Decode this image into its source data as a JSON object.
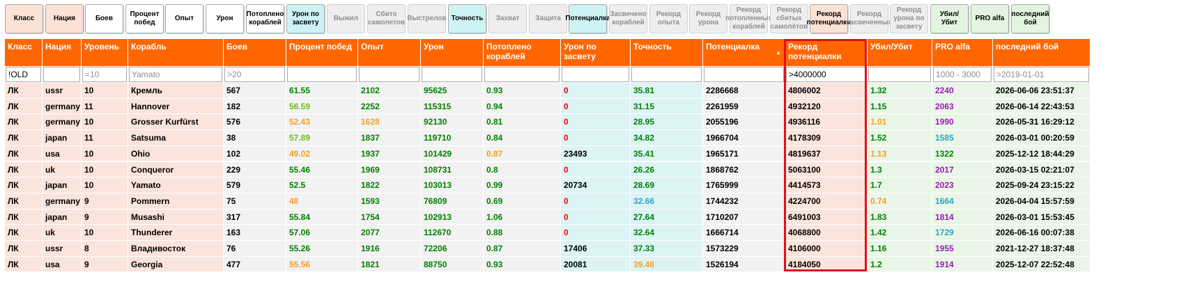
{
  "toggle_buttons": [
    {
      "label": "Класс",
      "state": "salmon"
    },
    {
      "label": "Нация",
      "state": "salmon"
    },
    {
      "label": "Боев",
      "state": "white"
    },
    {
      "label": "Процент побед",
      "state": "white"
    },
    {
      "label": "Опыт",
      "state": "white"
    },
    {
      "label": "Урон",
      "state": "white"
    },
    {
      "label": "Потоплено кораблей",
      "state": "white"
    },
    {
      "label": "Урон по засвету",
      "state": "cyan"
    },
    {
      "label": "Выжил",
      "state": "off"
    },
    {
      "label": "Сбито самолетов",
      "state": "off"
    },
    {
      "label": "Выстрелов",
      "state": "off"
    },
    {
      "label": "Точность",
      "state": "cyan"
    },
    {
      "label": "Захват",
      "state": "off"
    },
    {
      "label": "Защита",
      "state": "off"
    },
    {
      "label": "Потенциалка",
      "state": "cyan"
    },
    {
      "label": "Засвечено кораблей",
      "state": "off"
    },
    {
      "label": "Рекорд опыта",
      "state": "off"
    },
    {
      "label": "Рекорд урона",
      "state": "off"
    },
    {
      "label": "Рекорд потопленных кораблей",
      "state": "off"
    },
    {
      "label": "Рекорд сбитых самолётов",
      "state": "off"
    },
    {
      "label": "Рекорд потенциалки",
      "state": "salmon"
    },
    {
      "label": "Рекорд засвеченных",
      "state": "off"
    },
    {
      "label": "Рекорд урона по засвету",
      "state": "off"
    },
    {
      "label": "Убил/Убит",
      "state": "green"
    },
    {
      "label": "PRO alfa",
      "state": "green"
    },
    {
      "label": "последний бой",
      "state": "green"
    }
  ],
  "table": {
    "columns": [
      {
        "key": "class",
        "label": "Класс",
        "filter_value": "!OLD",
        "filter_placeholder": ""
      },
      {
        "key": "nation",
        "label": "Нация",
        "filter_value": "",
        "filter_placeholder": ""
      },
      {
        "key": "tier",
        "label": "Уровень",
        "filter_value": "",
        "filter_placeholder": "=10"
      },
      {
        "key": "ship",
        "label": "Корабль",
        "filter_value": "",
        "filter_placeholder": "Yamato"
      },
      {
        "key": "battles",
        "label": "Боев",
        "filter_value": "",
        "filter_placeholder": ">20"
      },
      {
        "key": "winrate",
        "label": "Процент побед",
        "filter_value": "",
        "filter_placeholder": ""
      },
      {
        "key": "xp",
        "label": "Опыт",
        "filter_value": "",
        "filter_placeholder": ""
      },
      {
        "key": "damage",
        "label": "Урон",
        "filter_value": "",
        "filter_placeholder": ""
      },
      {
        "key": "frags",
        "label": "Потоплено кораблей",
        "filter_value": "",
        "filter_placeholder": ""
      },
      {
        "key": "spot_dmg",
        "label": "Урон по засвету",
        "filter_value": "",
        "filter_placeholder": ""
      },
      {
        "key": "accuracy",
        "label": "Точность",
        "filter_value": "",
        "filter_placeholder": ""
      },
      {
        "key": "potential",
        "label": "Потенциалка",
        "filter_value": "",
        "filter_placeholder": "",
        "sort": "asc-arrow"
      },
      {
        "key": "rec_potential",
        "label": "Рекорд потенциалки",
        "filter_value": ">4000000",
        "filter_placeholder": ""
      },
      {
        "key": "kd",
        "label": "Убил/Убит",
        "filter_value": "",
        "filter_placeholder": ""
      },
      {
        "key": "pro",
        "label": "PRO alfa",
        "filter_value": "",
        "filter_placeholder": "1000 - 3000"
      },
      {
        "key": "last",
        "label": "последний бой",
        "filter_value": "",
        "filter_placeholder": ">2019-01-01"
      }
    ],
    "sort_indicator": "▲",
    "rows": [
      {
        "class": "ЛК",
        "nation": "ussr",
        "tier": "10",
        "ship": "Кремль",
        "battles": "567",
        "winrate": "61.55",
        "xp": "2102",
        "damage": "95625",
        "frags": "0.93",
        "spot_dmg": "0",
        "accuracy": "35.81",
        "potential": "2286668",
        "rec_potential": "4806002",
        "kd": "1.32",
        "pro": "2240",
        "last": "2026-06-06 23:51:37",
        "colors": {
          "winrate": "dgreen",
          "xp": "dgreen",
          "damage": "dgreen",
          "frags": "dgreen",
          "spot_dmg": "red",
          "accuracy": "dgreen",
          "kd": "dgreen",
          "pro": "purple"
        }
      },
      {
        "class": "ЛК",
        "nation": "germany",
        "tier": "11",
        "ship": "Hannover",
        "battles": "182",
        "winrate": "56.59",
        "xp": "2252",
        "damage": "115315",
        "frags": "0.94",
        "spot_dmg": "0",
        "accuracy": "31.15",
        "potential": "2261959",
        "rec_potential": "4932120",
        "kd": "1.15",
        "pro": "2063",
        "last": "2026-06-14 22:43:53",
        "colors": {
          "winrate": "lgreen",
          "xp": "dgreen",
          "damage": "dgreen",
          "frags": "dgreen",
          "spot_dmg": "red",
          "accuracy": "dgreen",
          "kd": "dgreen",
          "pro": "purple"
        }
      },
      {
        "class": "ЛК",
        "nation": "germany",
        "tier": "10",
        "ship": "Grosser Kurfürst",
        "battles": "576",
        "winrate": "52.43",
        "xp": "1628",
        "damage": "92130",
        "frags": "0.81",
        "spot_dmg": "0",
        "accuracy": "28.95",
        "potential": "2055196",
        "rec_potential": "4936116",
        "kd": "1.01",
        "pro": "1990",
        "last": "2026-05-31 16:29:12",
        "colors": {
          "winrate": "orange",
          "xp": "orange",
          "damage": "dgreen",
          "frags": "dgreen",
          "spot_dmg": "red",
          "accuracy": "dgreen",
          "kd": "orange",
          "pro": "purple"
        }
      },
      {
        "class": "ЛК",
        "nation": "japan",
        "tier": "11",
        "ship": "Satsuma",
        "battles": "38",
        "winrate": "57.89",
        "xp": "1837",
        "damage": "119710",
        "frags": "0.84",
        "spot_dmg": "0",
        "accuracy": "34.82",
        "potential": "1966704",
        "rec_potential": "4178309",
        "kd": "1.52",
        "pro": "1585",
        "last": "2026-03-01 00:20:59",
        "colors": {
          "winrate": "lgreen",
          "xp": "dgreen",
          "damage": "dgreen",
          "frags": "dgreen",
          "spot_dmg": "red",
          "accuracy": "dgreen",
          "kd": "dgreen",
          "pro": "teal"
        }
      },
      {
        "class": "ЛК",
        "nation": "usa",
        "tier": "10",
        "ship": "Ohio",
        "battles": "102",
        "winrate": "49.02",
        "xp": "1937",
        "damage": "101429",
        "frags": "0.87",
        "spot_dmg": "23493",
        "accuracy": "35.41",
        "potential": "1965171",
        "rec_potential": "4819637",
        "kd": "1.13",
        "pro": "1322",
        "last": "2025-12-12 18:44:29",
        "colors": {
          "winrate": "orange",
          "xp": "dgreen",
          "damage": "dgreen",
          "frags": "orange",
          "spot_dmg": "black",
          "accuracy": "dgreen",
          "kd": "orange",
          "pro": "dgreen"
        }
      },
      {
        "class": "ЛК",
        "nation": "uk",
        "tier": "10",
        "ship": "Conqueror",
        "battles": "229",
        "winrate": "55.46",
        "xp": "1969",
        "damage": "108731",
        "frags": "0.8",
        "spot_dmg": "0",
        "accuracy": "26.26",
        "potential": "1868762",
        "rec_potential": "5063100",
        "kd": "1.3",
        "pro": "2017",
        "last": "2026-03-15 02:21:07",
        "colors": {
          "winrate": "dgreen",
          "xp": "dgreen",
          "damage": "dgreen",
          "frags": "dgreen",
          "spot_dmg": "red",
          "accuracy": "dgreen",
          "kd": "dgreen",
          "pro": "purple"
        }
      },
      {
        "class": "ЛК",
        "nation": "japan",
        "tier": "10",
        "ship": "Yamato",
        "battles": "579",
        "winrate": "52.5",
        "xp": "1822",
        "damage": "103013",
        "frags": "0.99",
        "spot_dmg": "20734",
        "accuracy": "28.69",
        "potential": "1765999",
        "rec_potential": "4414573",
        "kd": "1.7",
        "pro": "2023",
        "last": "2025-09-24 23:15:22",
        "colors": {
          "winrate": "dgreen",
          "xp": "dgreen",
          "damage": "dgreen",
          "frags": "dgreen",
          "spot_dmg": "black",
          "accuracy": "dgreen",
          "kd": "dgreen",
          "pro": "purple"
        }
      },
      {
        "class": "ЛК",
        "nation": "germany",
        "tier": "9",
        "ship": "Pommern",
        "battles": "75",
        "winrate": "48",
        "xp": "1593",
        "damage": "76809",
        "frags": "0.69",
        "spot_dmg": "0",
        "accuracy": "32.66",
        "potential": "1744232",
        "rec_potential": "4224700",
        "kd": "0.74",
        "pro": "1664",
        "last": "2026-04-04 15:57:59",
        "colors": {
          "winrate": "orange",
          "xp": "dgreen",
          "damage": "dgreen",
          "frags": "dgreen",
          "spot_dmg": "red",
          "accuracy": "teal",
          "kd": "orange",
          "pro": "teal"
        }
      },
      {
        "class": "ЛК",
        "nation": "japan",
        "tier": "9",
        "ship": "Musashi",
        "battles": "317",
        "winrate": "55.84",
        "xp": "1754",
        "damage": "102913",
        "frags": "1.06",
        "spot_dmg": "0",
        "accuracy": "27.64",
        "potential": "1710207",
        "rec_potential": "6491003",
        "kd": "1.83",
        "pro": "1814",
        "last": "2026-03-01 15:53:45",
        "colors": {
          "winrate": "dgreen",
          "xp": "dgreen",
          "damage": "dgreen",
          "frags": "dgreen",
          "spot_dmg": "red",
          "accuracy": "dgreen",
          "kd": "dgreen",
          "pro": "purple"
        }
      },
      {
        "class": "ЛК",
        "nation": "uk",
        "tier": "10",
        "ship": "Thunderer",
        "battles": "163",
        "winrate": "57.06",
        "xp": "2077",
        "damage": "112670",
        "frags": "0.88",
        "spot_dmg": "0",
        "accuracy": "32.64",
        "potential": "1666714",
        "rec_potential": "4068800",
        "kd": "1.42",
        "pro": "1729",
        "last": "2026-06-16 00:07:38",
        "colors": {
          "winrate": "dgreen",
          "xp": "dgreen",
          "damage": "dgreen",
          "frags": "dgreen",
          "spot_dmg": "red",
          "accuracy": "dgreen",
          "kd": "dgreen",
          "pro": "teal"
        }
      },
      {
        "class": "ЛК",
        "nation": "ussr",
        "tier": "8",
        "ship": "Владивосток",
        "battles": "76",
        "winrate": "55.26",
        "xp": "1916",
        "damage": "72206",
        "frags": "0.87",
        "spot_dmg": "17406",
        "accuracy": "37.33",
        "potential": "1573229",
        "rec_potential": "4106000",
        "kd": "1.16",
        "pro": "1955",
        "last": "2021-12-27 18:37:48",
        "colors": {
          "winrate": "dgreen",
          "xp": "dgreen",
          "damage": "dgreen",
          "frags": "dgreen",
          "spot_dmg": "black",
          "accuracy": "dgreen",
          "kd": "dgreen",
          "pro": "purple"
        }
      },
      {
        "class": "ЛК",
        "nation": "usa",
        "tier": "9",
        "ship": "Georgia",
        "battles": "477",
        "winrate": "55.56",
        "xp": "1821",
        "damage": "88750",
        "frags": "0.93",
        "spot_dmg": "20081",
        "accuracy": "39.48",
        "potential": "1526194",
        "rec_potential": "4184050",
        "kd": "1.2",
        "pro": "1914",
        "last": "2025-12-07 22:52:48",
        "colors": {
          "winrate": "orange",
          "xp": "dgreen",
          "damage": "dgreen",
          "frags": "dgreen",
          "spot_dmg": "black",
          "accuracy": "orange",
          "kd": "dgreen",
          "pro": "purple"
        }
      }
    ]
  },
  "colors": {
    "header_bg": "#ff6600",
    "highlight_border": "#e0101b",
    "dgreen": "#008000",
    "lgreen": "#6fbb1a",
    "orange": "#f5a023",
    "red": "#ff0000",
    "teal": "#2aa6c5",
    "purple": "#9a1ab8",
    "black": "#000000"
  }
}
